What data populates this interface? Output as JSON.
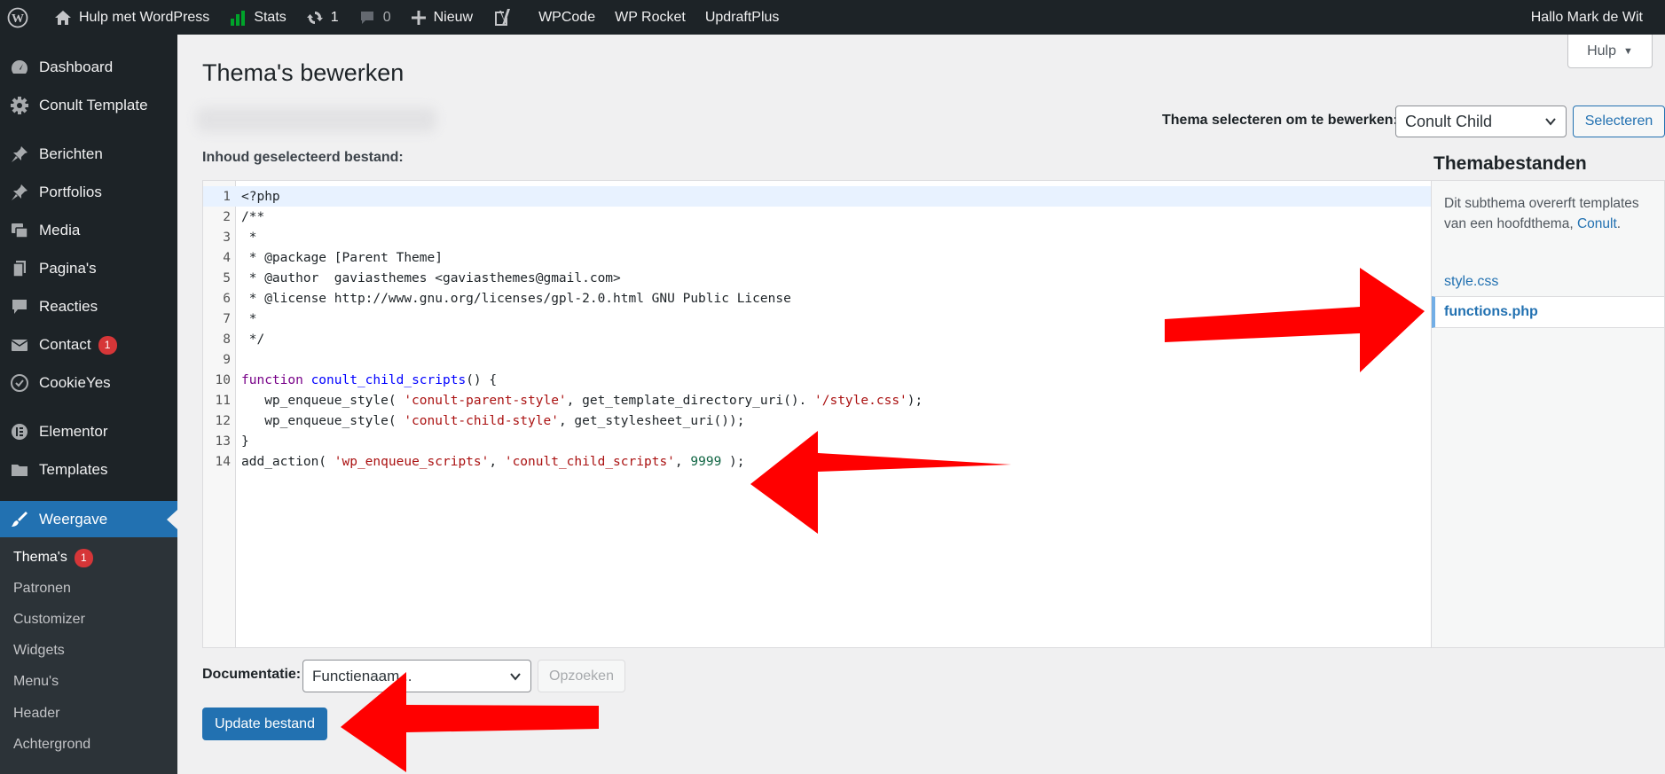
{
  "adminbar": {
    "site_name": "Hulp met WordPress",
    "stats_label": "Stats",
    "updates_count": "1",
    "comments_count": "0",
    "new_label": "Nieuw",
    "wpcode_label": "WPCode",
    "wprocket_label": "WP Rocket",
    "updraft_label": "UpdraftPlus",
    "greeting": "Hallo Mark de Wit"
  },
  "sidebar": {
    "items": [
      {
        "label": "Dashboard",
        "icon": "dashboard-icon"
      },
      {
        "label": "Conult Template",
        "icon": "gear-icon"
      },
      {
        "label": "Berichten",
        "icon": "pin-icon"
      },
      {
        "label": "Portfolios",
        "icon": "pin-icon"
      },
      {
        "label": "Media",
        "icon": "media-icon"
      },
      {
        "label": "Pagina's",
        "icon": "pages-icon"
      },
      {
        "label": "Reacties",
        "icon": "comment-icon"
      },
      {
        "label": "Contact",
        "icon": "mail-icon",
        "badge": "1"
      },
      {
        "label": "CookieYes",
        "icon": "cookie-icon"
      },
      {
        "label": "Elementor",
        "icon": "elementor-icon"
      },
      {
        "label": "Templates",
        "icon": "folder-icon"
      },
      {
        "label": "Weergave",
        "icon": "brush-icon"
      }
    ],
    "submenu": [
      {
        "label": "Thema's",
        "badge": "1"
      },
      {
        "label": "Patronen"
      },
      {
        "label": "Customizer"
      },
      {
        "label": "Widgets"
      },
      {
        "label": "Menu's"
      },
      {
        "label": "Header"
      },
      {
        "label": "Achtergrond"
      }
    ]
  },
  "main": {
    "title": "Thema's bewerken",
    "help_label": "Hulp",
    "theme_select_label": "Thema selecteren om te bewerken:",
    "theme_select_value": "Conult Child",
    "select_button": "Selecteren",
    "content_label": "Inhoud geselecteerd bestand:"
  },
  "code": {
    "lines": [
      "<?php",
      "/**",
      " *",
      " * @package [Parent Theme]",
      " * @author  gaviasthemes <gaviasthemes@gmail.com>",
      " * @license http://www.gnu.org/licenses/gpl-2.0.html GNU Public License",
      " *",
      " */",
      "",
      "function conult_child_scripts() {",
      "   wp_enqueue_style( 'conult-parent-style', get_template_directory_uri(). '/style.css');",
      "   wp_enqueue_style( 'conult-child-style', get_stylesheet_uri());",
      "}",
      "add_action( 'wp_enqueue_scripts', 'conult_child_scripts', 9999 );"
    ]
  },
  "files": {
    "title": "Themabestanden",
    "desc_prefix": "Dit subthema overerft templates van een hoofdthema,",
    "parent_link": "Conult",
    "desc_suffix": ".",
    "list": [
      "style.css",
      "functions.php"
    ],
    "current": "functions.php"
  },
  "documentation": {
    "label": "Documentatie:",
    "select_placeholder": "Functienaam...",
    "lookup_button": "Opzoeken"
  },
  "update_button": "Update bestand",
  "colors": {
    "adminbar_bg": "#1d2327",
    "accent": "#2271b1",
    "badge": "#d63638",
    "arrow": "#ff0000"
  }
}
